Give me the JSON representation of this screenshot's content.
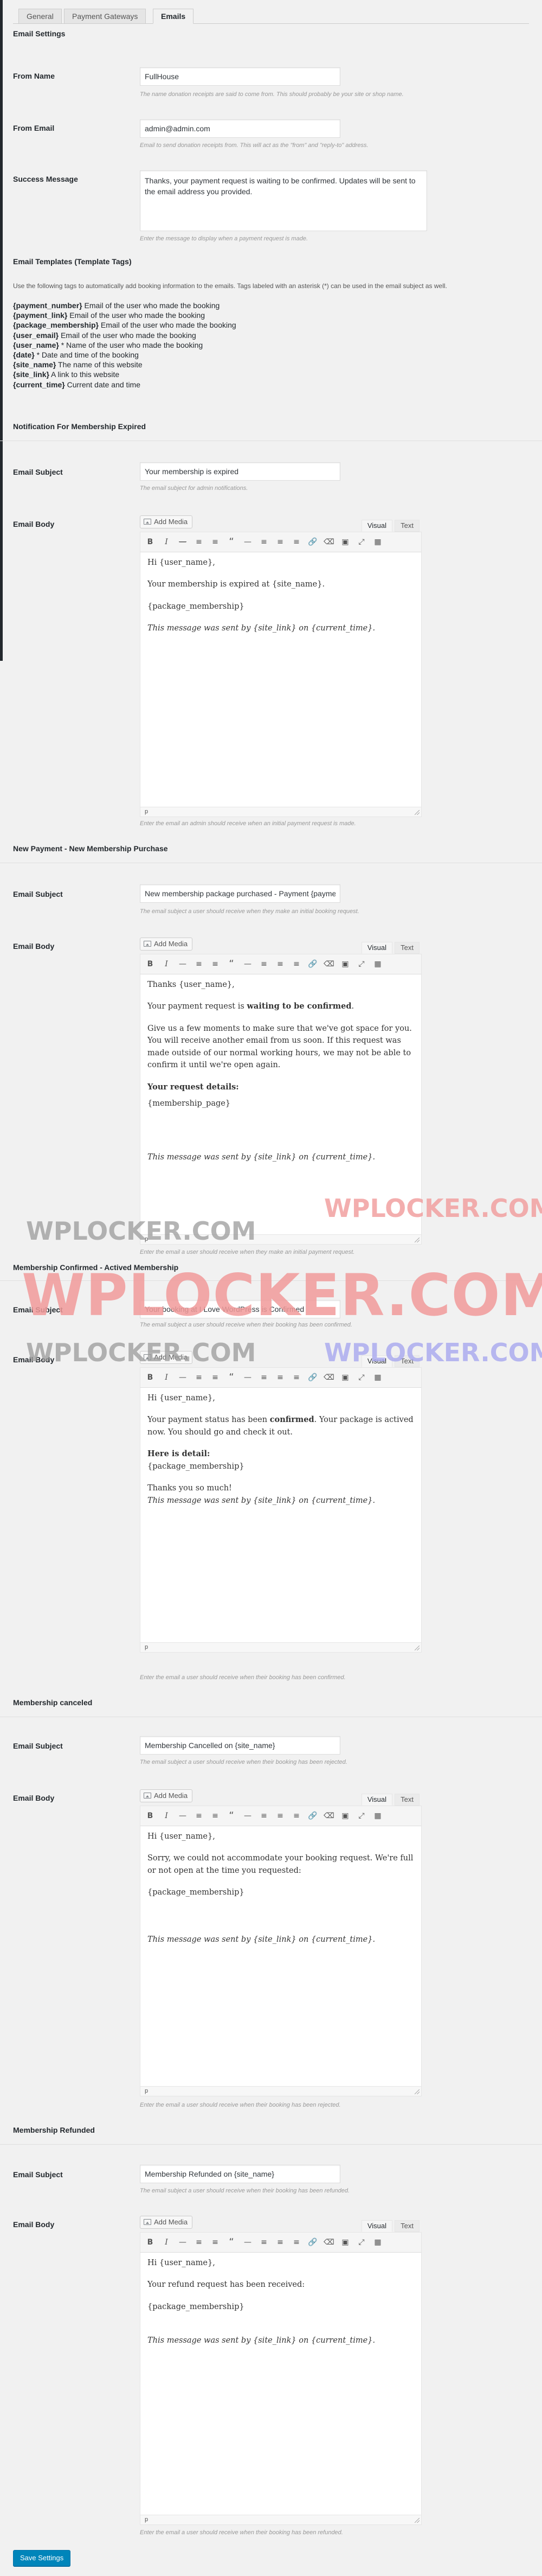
{
  "tabs": [
    "General",
    "Payment Gateways",
    "Emails"
  ],
  "headings": {
    "email_settings": "Email Settings",
    "email_templates": "Email Templates (Template Tags)",
    "notif_expired": "Notification For Membership Expired",
    "new_payment": "New Payment - New Membership Purchase",
    "confirmed": "Membership Confirmed - Actived Membership",
    "canceled": "Membership canceled",
    "refunded": "Membership Refunded"
  },
  "labels": {
    "from_name": "From Name",
    "from_email": "From Email",
    "success_message": "Success Message",
    "email_subject": "Email Subject",
    "email_body": "Email Body"
  },
  "fields": {
    "from_name": "FullHouse",
    "from_email": "admin@admin.com",
    "success_message": "Thanks, your payment request is waiting to be confirmed. Updates will be sent to the email address you provided."
  },
  "descs": {
    "from_name": "The name donation receipts are said to come from. This should probably be your site or shop name.",
    "from_email": "Email to send donation receipts from. This will act as the \"from\" and \"reply-to\" address.",
    "success_message": "Enter the message to display when a payment request is made.",
    "expired_subject": "The email subject for admin notifications.",
    "expired_body": "Enter the email an admin should receive when an initial payment request is made.",
    "new_subject": "The email subject a user should receive when they make an initial booking request.",
    "new_body": "Enter the email a user should receive when they make an initial payment request.",
    "confirmed_subject": "The email subject a user should receive when their booking has been confirmed.",
    "confirmed_body": "Enter the email a user should receive when their booking has been confirmed.",
    "canceled_subject": "The email subject a user should receive when their booking has been rejected.",
    "canceled_body": "Enter the email a user should receive when their booking has been rejected.",
    "refunded_subject": "The email subject a user should receive when their booking has been refunded.",
    "refunded_body": "Enter the email a user should receive when their booking has been refunded."
  },
  "templates_intro": "Use the following tags to automatically add booking information to the emails. Tags labeled with an asterisk (*) can be used in the email subject as well.",
  "tags": [
    {
      "tag": "{payment_number}",
      "desc": " Email of the user who made the booking"
    },
    {
      "tag": "{payment_link}",
      "desc": " Email of the user who made the booking"
    },
    {
      "tag": "{package_membership}",
      "desc": " Email of the user who made the booking"
    },
    {
      "tag": "{user_email}",
      "desc": " Email of the user who made the booking"
    },
    {
      "tag": "{user_name}",
      "desc": " * Name of the user who made the booking"
    },
    {
      "tag": "{date}",
      "desc": " * Date and time of the booking"
    },
    {
      "tag": "{site_name}",
      "desc": " The name of this website"
    },
    {
      "tag": "{site_link}",
      "desc": " A link to this website"
    },
    {
      "tag": "{current_time}",
      "desc": " Current date and time"
    }
  ],
  "editor": {
    "add_media": "Add Media",
    "visual": "Visual",
    "text": "Text",
    "path": "p",
    "toolbar_icons": [
      "bold-icon",
      "italic-icon",
      "strikethrough-icon",
      "bullet-list-icon",
      "numbered-list-icon",
      "blockquote-icon",
      "horizontal-rule-icon",
      "align-left-icon",
      "align-center-icon",
      "align-right-icon",
      "insert-link-icon",
      "remove-link-icon",
      "read-more-icon",
      "fullscreen-icon",
      "toolbar-toggle-icon"
    ]
  },
  "subjects": {
    "expired": "Your membership is expired",
    "new_payment": "New membership package purchased - Payment {payment_number}",
    "confirmed": "Your booking at I Love WordPress is Confirmed",
    "canceled": "Membership Cancelled on {site_name}",
    "refunded": "Membership Refunded on {site_name}"
  },
  "bodies": {
    "expired": {
      "greet": "Hi {user_name},",
      "line": "Your membership is expired at {site_name}.",
      "pkg": "{package_membership}",
      "sig": "This message was sent by {site_link} on {current_time}."
    },
    "new_payment": {
      "greet": "Thanks {user_name},",
      "line_a": "Your payment request is ",
      "line_b": "waiting to be confirmed",
      "line_c": ".",
      "para": "Give us a few moments to make sure that we've got space for you. You will receive another email from us soon. If this request was made outside of our normal working hours, we may not be able to confirm it until we're open again.",
      "details": "Your request details:",
      "pkg": "{membership_page}",
      "sig": "This message was sent by {site_link} on {current_time}."
    },
    "confirmed": {
      "greet": "Hi {user_name},",
      "line_a": "Your payment status has been ",
      "line_b": "confirmed",
      "line_c": ". Your package is actived now. You should go and check it out.",
      "details": "Here is detail:",
      "pkg": "{package_membership}",
      "thanks": "Thanks you so much!",
      "sig": "This message was sent by {site_link} on {current_time}."
    },
    "canceled": {
      "greet": "Hi {user_name},",
      "line": "Sorry, we could not accommodate your booking request. We're full or not open at the time you requested:",
      "pkg": "{package_membership}",
      "sig": "This message was sent by {site_link} on {current_time}."
    },
    "refunded": {
      "greet": "Hi {user_name},",
      "line": "Your refund request has been received:",
      "pkg": "{package_membership}",
      "sig": "This message was sent by {site_link} on {current_time}."
    }
  },
  "watermarks": [
    "WPLOCKER.COM",
    "WPLOCKER.COM",
    "WPLOCKER.COM",
    "WPLOCKER.COM",
    "WPLOCKER.COM"
  ],
  "save_button": "Save Settings",
  "colors": {
    "primary": "#0085ba",
    "watermark_gray": "#9b9b9b",
    "watermark_red": "#f19b9b",
    "watermark_blue": "#a8a8ef"
  }
}
